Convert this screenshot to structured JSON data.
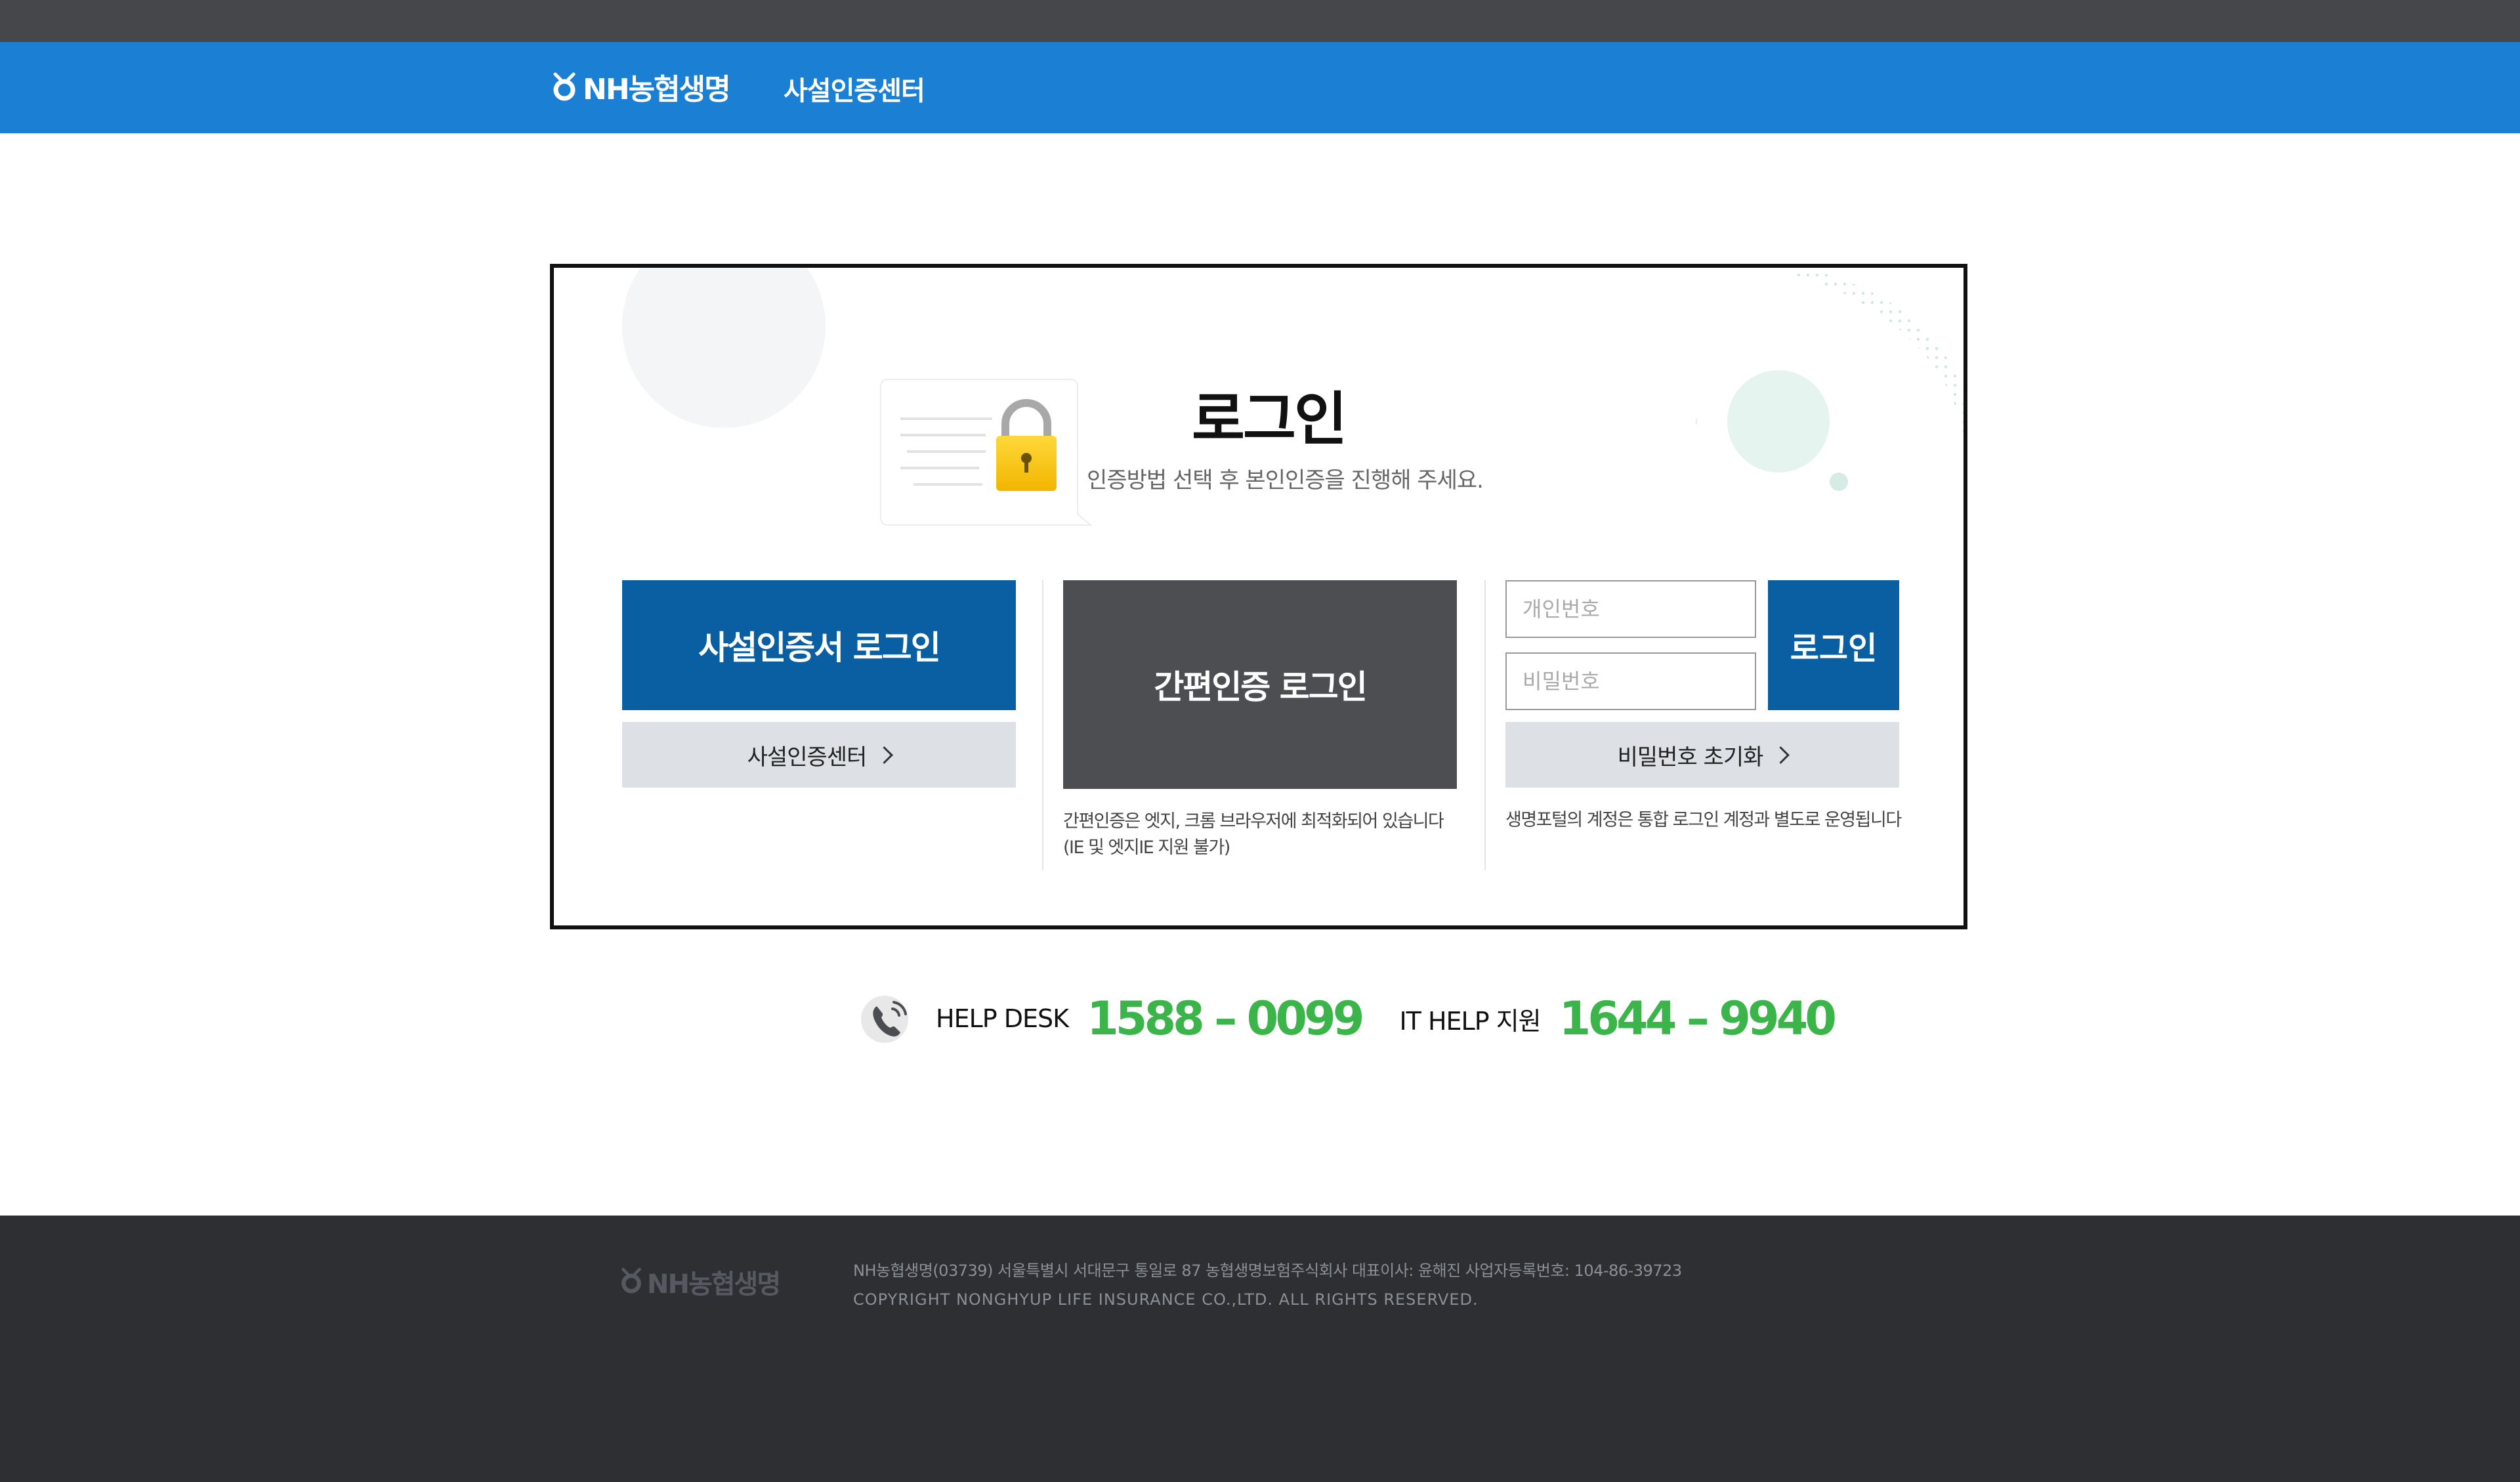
{
  "header": {
    "logo_text": "NH농협생명",
    "site_title": "사설인증센터"
  },
  "main": {
    "title": "로그인",
    "subtitle": "인증방법 선택 후 본인인증을 진행해 주세요."
  },
  "private_cert": {
    "login_label": "사설인증서 로그인",
    "center_link_label": "사설인증센터"
  },
  "simple_auth": {
    "login_label": "간편인증 로그인",
    "note_line1": "간편인증은 엣지, 크롬 브라우저에 최적화되어 있습니다",
    "note_line2": "(IE 및 엣지IE 지원 불가)"
  },
  "id_login": {
    "pin_placeholder": "개인번호",
    "password_placeholder": "비밀번호",
    "login_label": "로그인",
    "reset_label": "비밀번호 초기화",
    "note": "생명포털의 계정은 통합 로그인 계정과 별도로 운영됩니다"
  },
  "helpdesk": {
    "label": "HELP DESK",
    "number": "1588 – 0099",
    "it_label": "IT HELP 지원",
    "it_number": "1644 – 9940"
  },
  "footer": {
    "logo_text": "NH농협생명",
    "address": "NH농협생명(03739) 서울특별시 서대문구 통일로 87 농협생명보험주식회사 대표이사: 윤해진 사업자등록번호: 104-86-39723",
    "copyright": "COPYRIGHT NONGHYUP LIFE INSURANCE CO.,LTD. ALL RIGHTS RESERVED."
  },
  "colors": {
    "header_blue": "#1b7fd4",
    "primary_button": "#0a5fa3",
    "dark_button": "#4c4e52",
    "helpdesk_green": "#3bb54a",
    "footer_bg": "#2d2f33"
  },
  "icons": {
    "logo": "nh-logo-icon",
    "lock": "lock-icon",
    "phone": "phone-icon",
    "chevron": "chevron-right-icon"
  }
}
